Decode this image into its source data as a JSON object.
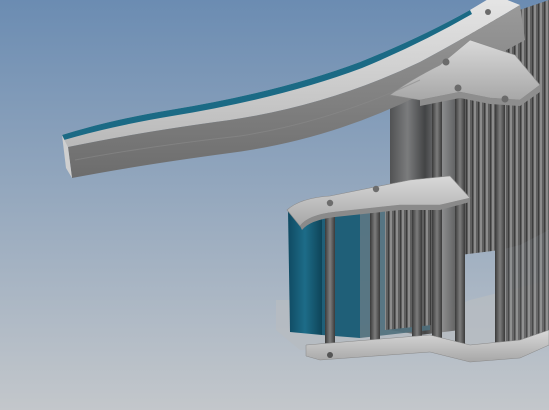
{
  "viewport": {
    "background_top": "#6b8cb2",
    "background_bottom": "#c3c7cb"
  },
  "colors": {
    "metal_light": "#d4d4d4",
    "metal_mid": "#a8a8a8",
    "metal_dark": "#5a5a5a",
    "belt_teal": "#145a72",
    "belt_teal_light": "#2a7f9a",
    "post_dark": "#4a4a4a"
  },
  "model": {
    "name": "",
    "parts": [
      "curved-rail",
      "upper-bracket-plate",
      "middle-bracket-plate",
      "base-plate",
      "teal-panel",
      "vertical-post",
      "slatted-wall",
      "mounting-hole"
    ]
  }
}
